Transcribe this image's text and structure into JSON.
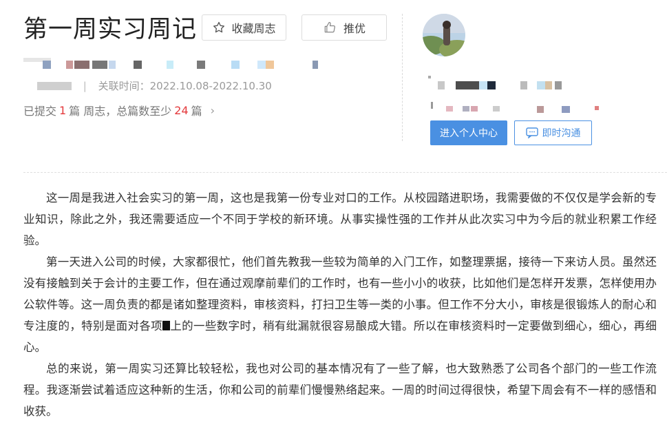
{
  "header": {
    "title": "第一周实习周记",
    "favorite_label": "收藏周志",
    "recommend_label": "推优",
    "favorite_icon": "star-icon",
    "recommend_icon": "thumbs-up-icon"
  },
  "meta": {
    "time_label": "关联时间：2022.10.08-2022.10.30"
  },
  "counts": {
    "prefix": "已提交",
    "submitted": "1",
    "mid": "篇 周志，总篇数至少",
    "minimum": "24",
    "suffix": "篇",
    "chevron": "›"
  },
  "profile": {
    "center_button": "进入个人中心",
    "chat_button": "即时沟通",
    "chat_icon": "chat-bubble-icon",
    "accent_color": "#4a90e2"
  },
  "article": {
    "paragraphs": [
      "这一周是我进入社会实习的第一周，这也是我第一份专业对口的工作。从校园踏进职场，我需要做的不仅仅是学会新的专业知识，除此之外，我还需要适应一个不同于学校的新环境。从事实操性强的工作并从此次实习中为今后的就业积累工作经验。",
      "第一天进入公司的时候，大家都很忙，他们首先教我一些较为简单的入门工作，如整理票据，接待一下来访人员。虽然还没有接触到关于会计的主要工作，但在通过观摩前辈们的工作时，也有一些小小的收获，比如他们是怎样开发票，怎样使用办公软件等。这一周负责的都是诸如整理资料，审核资料，打扫卫生等一类的小事。但工作不分大小，审核是很锻炼人的耐心和专注度的，特别是面对各项",
      "上的一些数字时，稍有纰漏就很容易酿成大错。所以在审核资料时一定要做到细心，细心，再细心。",
      "总的来说，第一周实习还算比较轻松，我也对公司的基本情况有了一些了解，也大致熟悉了公司各个部门的一些工作流程。我逐渐尝试着适应这种新的生活，你和公司的前辈们慢慢熟络起来。一周的时间过得很快，希望下周会有不一样的感悟和收获。"
    ]
  }
}
